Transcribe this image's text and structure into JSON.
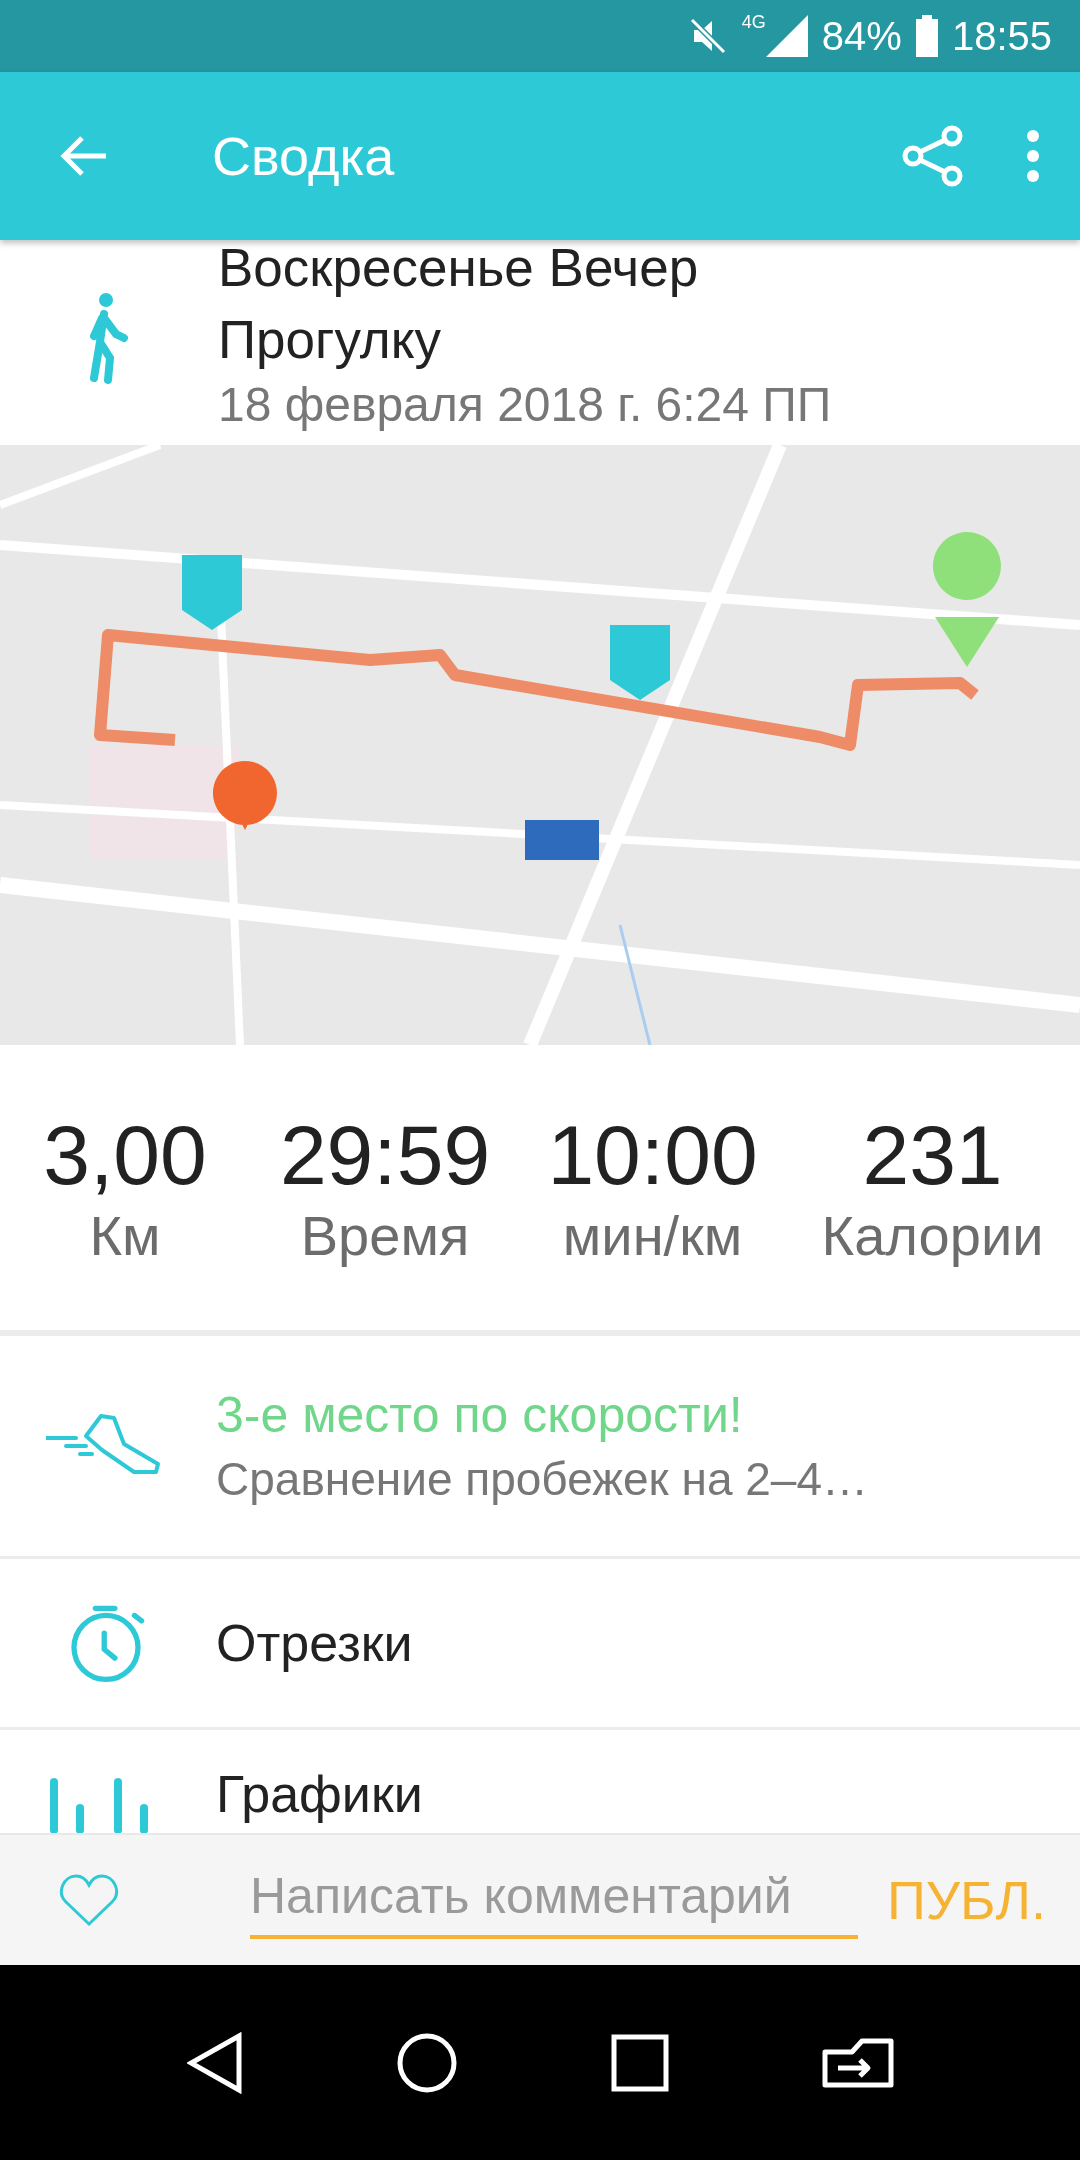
{
  "status_bar": {
    "network": "4G",
    "battery": "84%",
    "time": "18:55"
  },
  "toolbar": {
    "title": "Сводка"
  },
  "activity": {
    "title": "Воскресенье Вечер Прогулку",
    "date": "18 февраля 2018 г. 6:24 ПП"
  },
  "stats": [
    {
      "value": "3,00",
      "label": "Км"
    },
    {
      "value": "29:59",
      "label": "Время"
    },
    {
      "value": "10:00",
      "label": "мин/км"
    },
    {
      "value": "231",
      "label": "Калории"
    }
  ],
  "rows": [
    {
      "kind": "achievement",
      "title": "3-е место по скорости!",
      "subtitle": "Сравнение пробежек на 2–4…"
    },
    {
      "kind": "splits",
      "title": "Отрезки"
    },
    {
      "kind": "graphs",
      "title": "Графики"
    }
  ],
  "comment_bar": {
    "placeholder": "Написать комментарий",
    "button": "ПУБЛ.",
    "liked": false
  }
}
